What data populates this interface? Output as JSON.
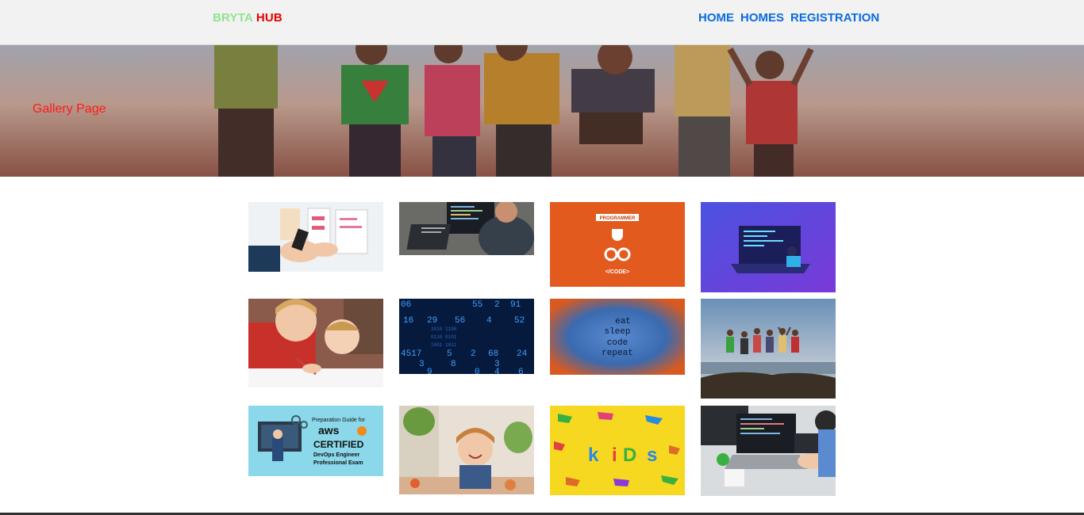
{
  "brand": {
    "part1": "BRYTA",
    "part2": "HUB",
    "color1": "#8fe38f",
    "color2": "#e60000"
  },
  "nav": {
    "items": [
      "HOME",
      "HOMES",
      "REGISTRATION"
    ],
    "color": "#0a6cde"
  },
  "hero": {
    "title": "Gallery Page",
    "title_color": "#ff1a1a"
  },
  "gallery": {
    "tile1_text": "",
    "programmer_label": "PROGRAMMER",
    "code_label": "</CODE>",
    "eat_sleep": [
      "eat",
      "sleep",
      "code",
      "repeat"
    ],
    "aws": {
      "line1": "Preparation Guide for",
      "line2": "aws",
      "line3": "CERTIFIED",
      "line4": "DevOps Engineer",
      "line5": "Professional Exam"
    },
    "kids_word": [
      "k",
      "i",
      "D",
      "s"
    ],
    "binary_digits": "06 55 2 91 16 29 56 4 52 4517 5 2 68 24 3 9 8 3 8 4 0 4 6"
  }
}
